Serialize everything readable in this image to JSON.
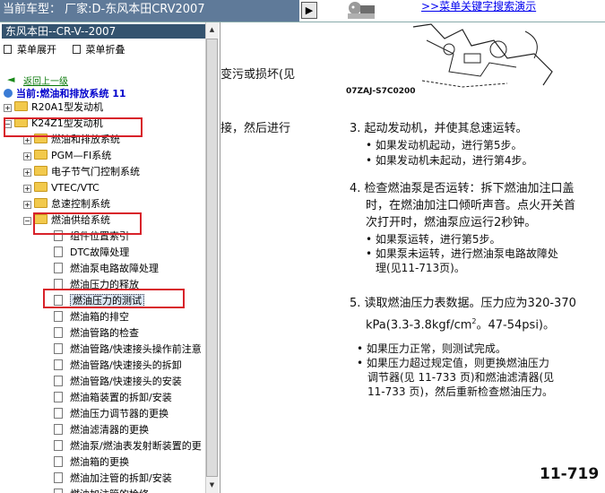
{
  "header": {
    "vehicle_label": "当前车型：  厂家:D-东风本田CRV2007",
    "search_link": ">>菜单关键字搜索演示"
  },
  "sidebar": {
    "title": "东风本田--CR-V--2007",
    "expand_label": "菜单展开",
    "collapse_label": "菜单折叠",
    "back_link": "返回上一级",
    "current_label": "当前:燃油和排放系统 11",
    "tree": [
      {
        "label": "R20A1型发动机",
        "level": 0,
        "type": "folder",
        "state": "collapsed"
      },
      {
        "label": "K24Z1型发动机",
        "level": 0,
        "type": "folder",
        "state": "expanded"
      },
      {
        "label": "燃油和排放系统",
        "level": 1,
        "type": "folder",
        "state": "collapsed"
      },
      {
        "label": "PGM—FI系统",
        "level": 1,
        "type": "folder",
        "state": "collapsed"
      },
      {
        "label": "电子节气门控制系统",
        "level": 1,
        "type": "folder",
        "state": "collapsed"
      },
      {
        "label": "VTEC/VTC",
        "level": 1,
        "type": "folder",
        "state": "collapsed"
      },
      {
        "label": "怠速控制系统",
        "level": 1,
        "type": "folder",
        "state": "collapsed"
      },
      {
        "label": "燃油供给系统",
        "level": 1,
        "type": "folder",
        "state": "expanded"
      },
      {
        "label": "组件位置索引",
        "level": 2,
        "type": "doc"
      },
      {
        "label": "DTC故障处理",
        "level": 2,
        "type": "doc"
      },
      {
        "label": "燃油泵电路故障处理",
        "level": 2,
        "type": "doc"
      },
      {
        "label": "燃油压力的释放",
        "level": 2,
        "type": "doc"
      },
      {
        "label": "燃油压力的测试",
        "level": 2,
        "type": "doc",
        "selected": true
      },
      {
        "label": "燃油箱的排空",
        "level": 2,
        "type": "doc"
      },
      {
        "label": "燃油管路的检查",
        "level": 2,
        "type": "doc"
      },
      {
        "label": "燃油管路/快速接头操作前注意",
        "level": 2,
        "type": "doc"
      },
      {
        "label": "燃油管路/快速接头的拆卸",
        "level": 2,
        "type": "doc"
      },
      {
        "label": "燃油管路/快速接头的安装",
        "level": 2,
        "type": "doc"
      },
      {
        "label": "燃油箱装置的拆卸/安装",
        "level": 2,
        "type": "doc"
      },
      {
        "label": "燃油压力调节器的更换",
        "level": 2,
        "type": "doc"
      },
      {
        "label": "燃油滤清器的更换",
        "level": 2,
        "type": "doc"
      },
      {
        "label": "燃油泵/燃油表发射断装置的更",
        "level": 2,
        "type": "doc"
      },
      {
        "label": "燃油箱的更换",
        "level": 2,
        "type": "doc"
      },
      {
        "label": "燃油加注管的拆卸/安装",
        "level": 2,
        "type": "doc"
      },
      {
        "label": "燃油加注管的检修",
        "level": 2,
        "type": "doc"
      }
    ]
  },
  "content": {
    "partial_line1": "变污或损坏(见",
    "partial_line2": "接，然后进行",
    "figure_code": "07ZAJ-S7C0200",
    "step3": {
      "num": "3.",
      "text": "起动发动机，并使其怠速运转。",
      "bullets": [
        "如果发动机起动，进行第5步。",
        "如果发动机未起动，进行第4步。"
      ]
    },
    "step4": {
      "num": "4.",
      "lines": [
        "检查燃油泵是否运转：拆下燃油加注口盖",
        "时，在燃油加注口倾听声音。点火开关首",
        "次打开时，燃油泵应运行2秒钟。"
      ],
      "bullets": [
        "如果泵运转，进行第5步。",
        "如果泵未运转，进行燃油泵电路故障处",
        "理(见11-713页)。"
      ]
    },
    "step5": {
      "num": "5.",
      "line1": "读取燃油压力表数据。压力应为320-370",
      "line2": "kPa(3.3-3.8kgf/cm",
      "line2_sup": "2",
      "line2_end": "。47-54psi)。",
      "bullets": [
        "如果压力正常，则测试完成。",
        "如果压力超过规定值，则更换燃油压力",
        "调节器(见  11-733 页)和燃油滤清器(见",
        "11-733 页)，然后重新检查燃油压力。"
      ]
    },
    "page_number": "11-719"
  }
}
